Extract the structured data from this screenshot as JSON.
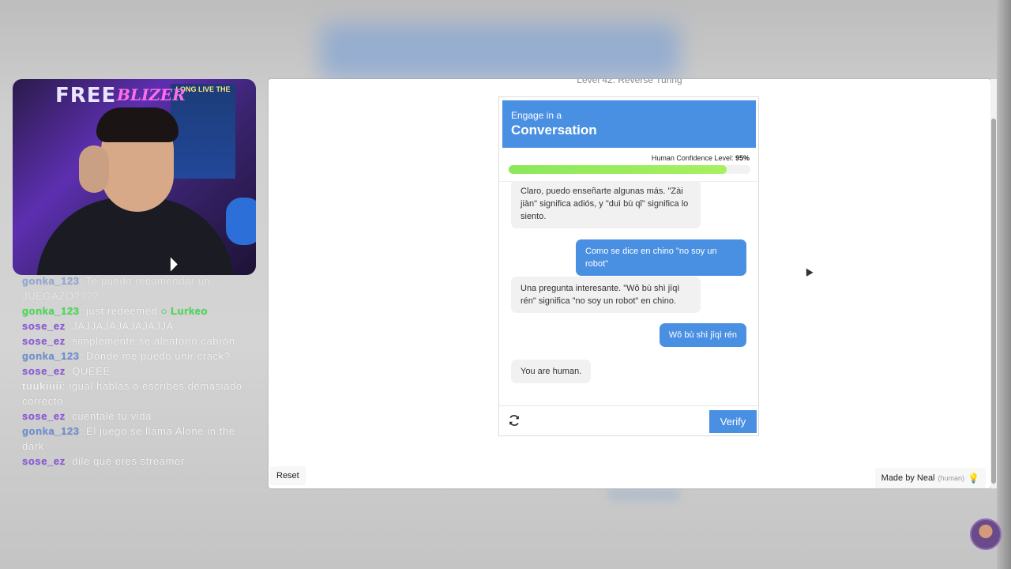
{
  "webcam": {
    "sign_left": "FREE",
    "sign_right": "BLIZER",
    "poster_text": "LONG LIVE THE"
  },
  "chat": [
    {
      "user": "gonka_123",
      "text": "Te puedo recomendar un JUEGAZO????",
      "color": "blue",
      "dim": true
    },
    {
      "user": "gonka_123",
      "text": "just redeemed",
      "extra": "Lurkeo",
      "color": "green",
      "dim": false
    },
    {
      "user": "sose_ez",
      "text": "JAJJAJAJAJAJAJJA",
      "color": "purple"
    },
    {
      "user": "sose_ez",
      "text": "simplemente se aleatorio cabrón",
      "color": "purple"
    },
    {
      "user": "gonka_123",
      "text": "Dónde me puedo unir crack?",
      "color": "blue"
    },
    {
      "user": "sose_ez",
      "text": "QUEEE",
      "color": "purple"
    },
    {
      "user": "tuukiiiii",
      "text": "igual hablas o escribes demasiado correcto",
      "color": "white"
    },
    {
      "user": "sose_ez",
      "text": "cuentale tu vida",
      "color": "purple"
    },
    {
      "user": "gonka_123",
      "text": "El juego se llama Alone in the dark",
      "color": "blue"
    },
    {
      "user": "sose_ez",
      "text": "dile que eres streamer",
      "color": "purple"
    }
  ],
  "window": {
    "level_title": "Level 42: Reverse Turing",
    "captcha": {
      "header_small": "Engage in a",
      "header_big": "Conversation",
      "confidence_label": "Human Confidence Level:",
      "confidence_value": "95%",
      "confidence_fraction": 0.95,
      "messages": [
        {
          "from": "bot",
          "text": "Claro, puedo enseñarte algunas más. \"Zài jiàn\" significa adiós, y \"duì bù qǐ\" significa lo siento."
        },
        {
          "from": "user",
          "text": "Como se dice en chino \"no soy un robot\""
        },
        {
          "from": "bot",
          "text": "Una pregunta interesante. \"Wǒ bù shì jīqì rén\" significa \"no soy un robot\" en chino."
        },
        {
          "from": "user",
          "text": "Wǒ bù shì jīqì rén"
        },
        {
          "from": "bot",
          "text": "You are human."
        }
      ],
      "verify_label": "Verify",
      "refresh_icon": "refresh-icon"
    },
    "reset_label": "Reset",
    "made_by": "Made by Neal",
    "made_by_note": "(human)",
    "accent_color": "#4a90e2"
  }
}
